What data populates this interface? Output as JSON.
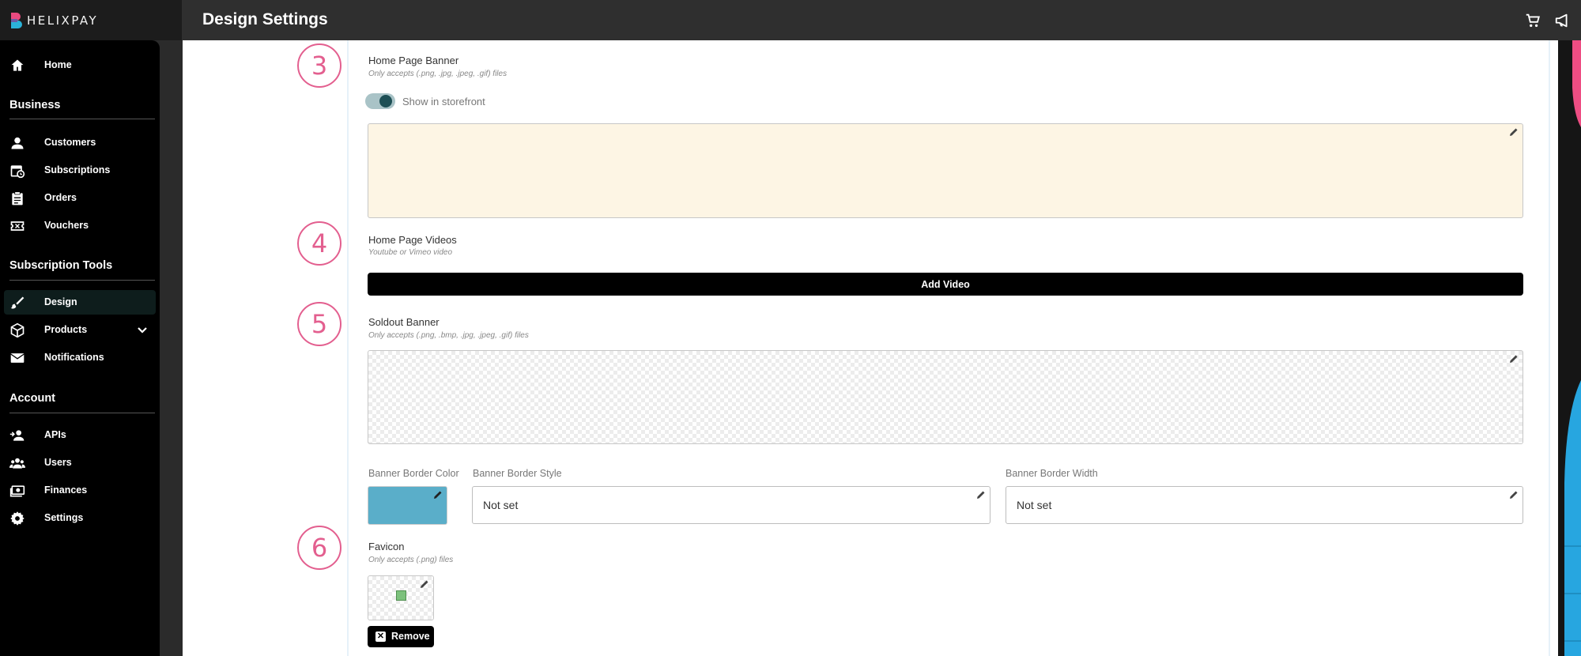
{
  "app": {
    "brand": "HELIXPAY",
    "page_title": "Design Settings"
  },
  "topbar": {
    "icons": [
      "cart-icon",
      "megaphone-icon"
    ]
  },
  "sidebar": {
    "home": "Home",
    "sections": {
      "business": "Business",
      "subscription_tools": "Subscription Tools",
      "account": "Account"
    },
    "items": {
      "customers": "Customers",
      "subscriptions": "Subscriptions",
      "orders": "Orders",
      "vouchers": "Vouchers",
      "design": "Design",
      "products": "Products",
      "notifications": "Notifications",
      "apis": "APIs",
      "users": "Users",
      "finances": "Finances",
      "settings": "Settings"
    },
    "active": "design"
  },
  "steps": [
    "3",
    "4",
    "5",
    "6"
  ],
  "home_banner": {
    "title": "Home Page Banner",
    "subtitle": "Only accepts (.png, .jpg, .jpeg, .gif) files",
    "toggle_label": "Show in storefront",
    "toggle_on": true,
    "background": "#fdf5e4"
  },
  "home_videos": {
    "title": "Home Page Videos",
    "subtitle": "Youtube or Vimeo video",
    "add_button": "Add Video"
  },
  "soldout_banner": {
    "title": "Soldout Banner",
    "subtitle": "Only accepts (.png, .bmp, .jpg, .jpeg, .gif) files"
  },
  "banner_border": {
    "color_label": "Banner Border Color",
    "color_value": "#5aaec9",
    "style_label": "Banner Border Style",
    "style_value": "Not set",
    "width_label": "Banner Border Width",
    "width_value": "Not set"
  },
  "favicon": {
    "title": "Favicon",
    "subtitle": "Only accepts (.png) files",
    "remove_button": "Remove"
  },
  "colors": {
    "accent": "#e35f8f",
    "sidebar_bg": "#000000",
    "topbar_bg": "#2f2f2f"
  }
}
